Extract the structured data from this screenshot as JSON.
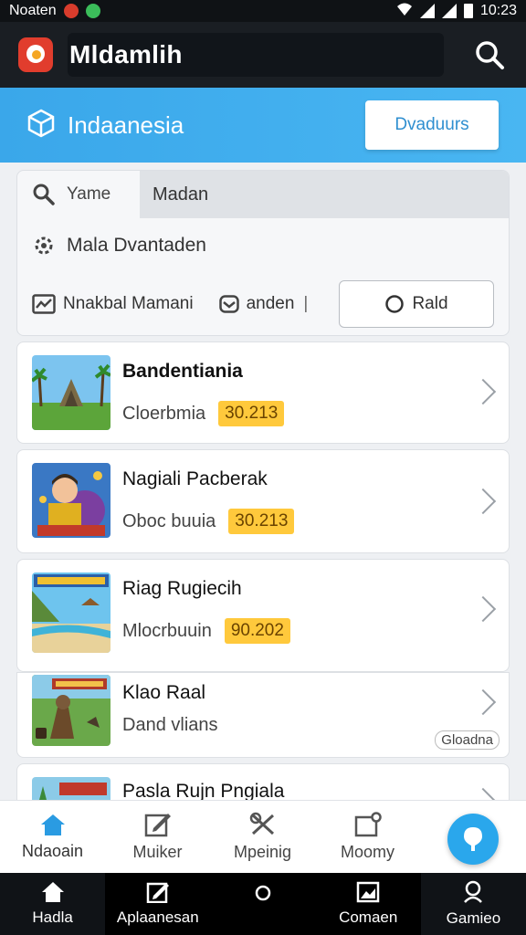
{
  "status_bar": {
    "carrier": "Noaten",
    "time": "10:23"
  },
  "app_bar": {
    "title": "Mldamlih",
    "search_icon": "search-icon"
  },
  "region": {
    "title": "Indaanesia",
    "button": "Dvaduurs",
    "icon": "cube-icon"
  },
  "filters": {
    "row1_label": "Yame",
    "row1_value": "Madan",
    "row2_label": "Mala Dvantaden",
    "row3_item1": "Nnakbal Mamani",
    "row3_item2": "anden",
    "row3_sep": "|",
    "button": "Rald"
  },
  "list": [
    {
      "title": "Bandentiania",
      "subtitle": "Cloerbmia",
      "badge": "30.213"
    },
    {
      "title": "Nagiali Pacberak",
      "subtitle": "Oboc buuia",
      "badge": "30.213"
    },
    {
      "title": "Riag Rugiecih",
      "subtitle": "Mlocrbuuin",
      "badge": "90.202"
    },
    {
      "title": "Klao Raal",
      "subtitle": "Dand vlians",
      "tag": "Gloadna"
    },
    {
      "title": "Pasla Rujn Pngiala"
    }
  ],
  "bottom_nav": [
    {
      "label": "Ndaoain",
      "icon": "home-icon"
    },
    {
      "label": "Muiker",
      "icon": "edit-icon"
    },
    {
      "label": "Mpeinig",
      "icon": "tools-icon"
    },
    {
      "label": "Moomy",
      "icon": "share-icon"
    }
  ],
  "fab_icon": "location-icon",
  "system_bar": [
    {
      "label": "Hadla",
      "icon": "home-icon"
    },
    {
      "label": "Aplaanesan",
      "icon": "edit-icon"
    },
    {
      "label": "",
      "icon": "circle-icon"
    },
    {
      "label": "Comaen",
      "icon": "image-icon"
    },
    {
      "label": "Gamieo",
      "icon": "profile-icon"
    }
  ]
}
